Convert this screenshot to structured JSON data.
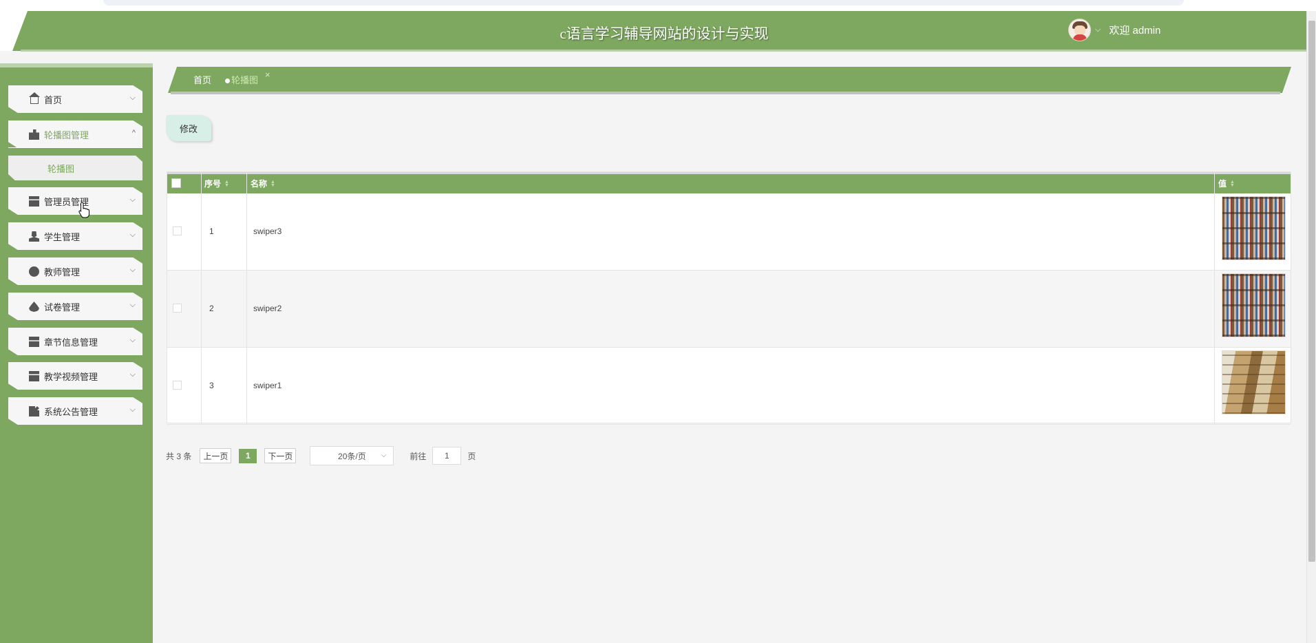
{
  "header": {
    "site_title": "c语言学习辅导网站的设计与实现",
    "welcome": "欢迎 admin",
    "chevron": "⌵"
  },
  "sidebar": {
    "items": [
      {
        "label": "首页",
        "icon": "home-icon",
        "chevron": "⌵"
      },
      {
        "label": "轮播图管理",
        "icon": "image-icon",
        "chevron": "^",
        "expanded": true
      },
      {
        "label": "管理员管理",
        "icon": "archive-icon",
        "chevron": "⌵"
      },
      {
        "label": "学生管理",
        "icon": "user-icon",
        "chevron": "⌵"
      },
      {
        "label": "教师管理",
        "icon": "teacher-icon",
        "chevron": "⌵"
      },
      {
        "label": "试卷管理",
        "icon": "drop-icon",
        "chevron": "⌵"
      },
      {
        "label": "章节信息管理",
        "icon": "list-icon",
        "chevron": "⌵"
      },
      {
        "label": "教学视频管理",
        "icon": "video-icon",
        "chevron": "⌵"
      },
      {
        "label": "系统公告管理",
        "icon": "notice-icon",
        "chevron": "⌵"
      }
    ],
    "submenu": {
      "label": "轮播图"
    }
  },
  "breadcrumb": {
    "home": "首页",
    "current": "轮播图",
    "close": "×"
  },
  "toolbar": {
    "edit_label": "修改"
  },
  "table": {
    "columns": [
      "序号",
      "名称",
      "值"
    ],
    "rows": [
      {
        "index": "1",
        "name": "swiper3",
        "image": "bookshelf-photo"
      },
      {
        "index": "2",
        "name": "swiper2",
        "image": "bookshelf-photo"
      },
      {
        "index": "3",
        "name": "swiper1",
        "image": "library-photo"
      }
    ]
  },
  "pagination": {
    "total": "共 3 条",
    "prev": "上一页",
    "current_page": "1",
    "next": "下一页",
    "page_size": "20条/页",
    "goto_label": "前往",
    "goto_value": "1",
    "page_suffix": "页"
  },
  "colors": {
    "primary": "#7ea860",
    "edit_button": "#d7efe7"
  }
}
